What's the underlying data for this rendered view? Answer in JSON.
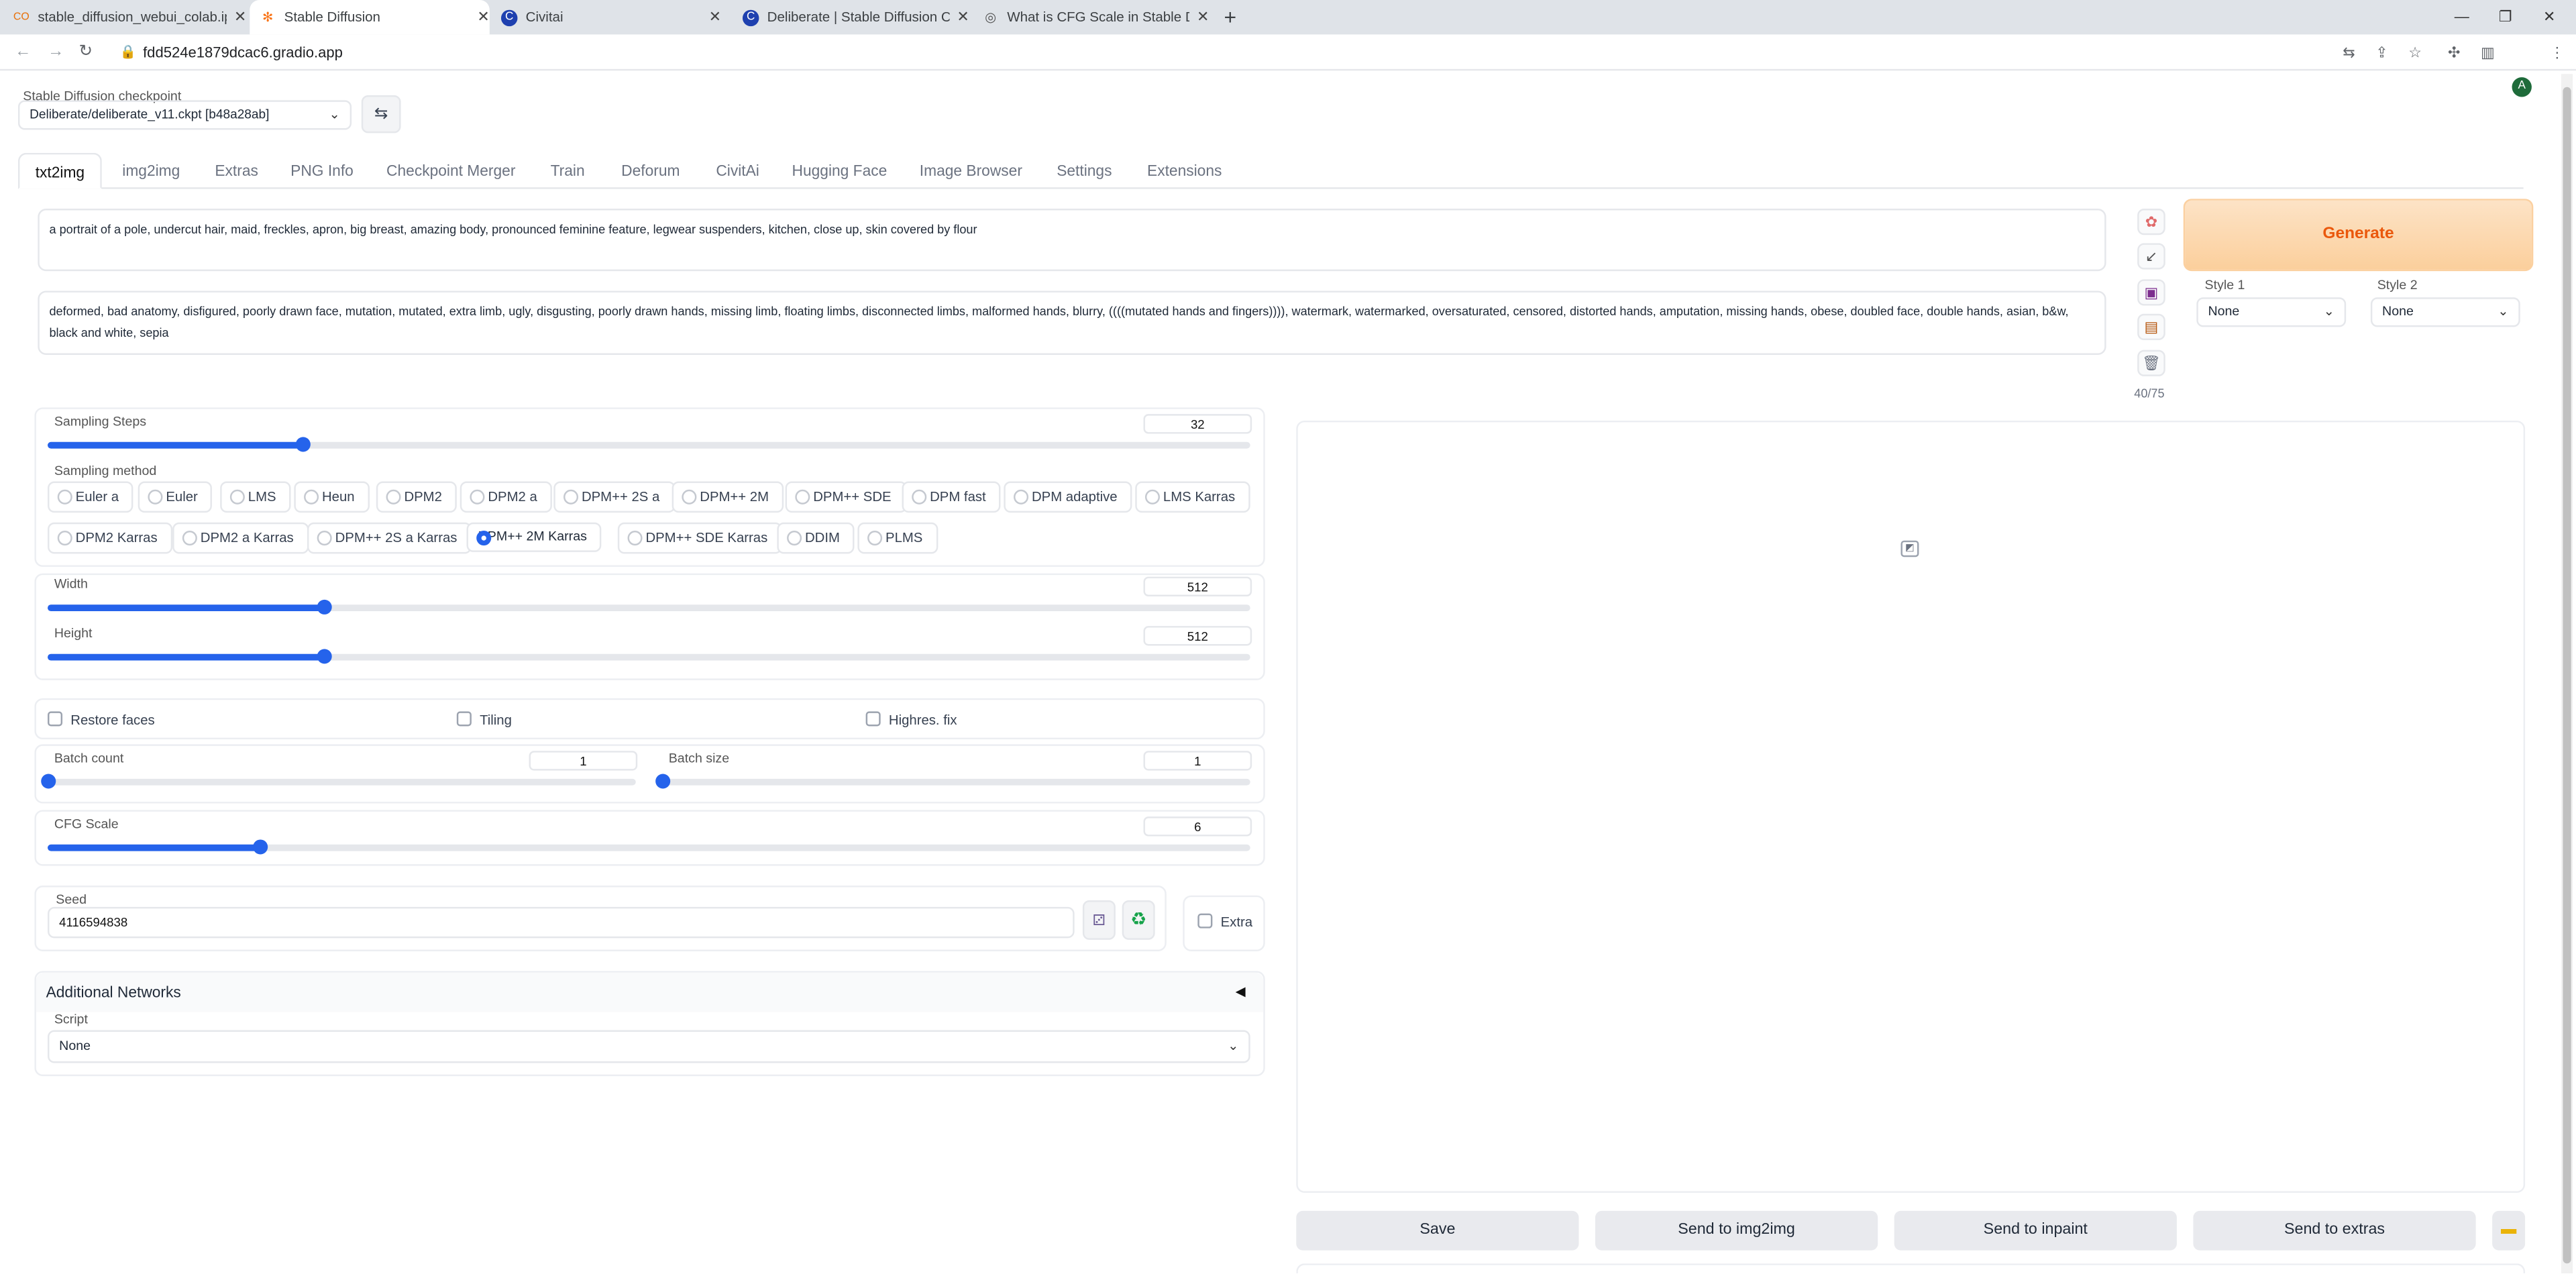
{
  "browser": {
    "tabs": [
      {
        "title": "stable_diffusion_webui_colab.ipynb",
        "icon": "CO"
      },
      {
        "title": "Stable Diffusion",
        "icon": "✻"
      },
      {
        "title": "Civitai",
        "icon": "C"
      },
      {
        "title": "Deliberate | Stable Diffusion Checkpoint",
        "icon": "C"
      },
      {
        "title": "What is CFG Scale in Stable Diffusion",
        "icon": "◎"
      }
    ],
    "url": "fdd524e1879dcac6.gradio.app",
    "avatar": "A"
  },
  "checkpoint": {
    "label": "Stable Diffusion checkpoint",
    "value": "Deliberate/deliberate_v11.ckpt [b48a28ab]"
  },
  "tabs": [
    "txt2img",
    "img2img",
    "Extras",
    "PNG Info",
    "Checkpoint Merger",
    "Train",
    "Deforum",
    "CivitAi",
    "Hugging Face",
    "Image Browser",
    "Settings",
    "Extensions"
  ],
  "prompt": "a portrait of a pole, undercut hair, maid, freckles, apron, big breast, amazing body, pronounced feminine feature, legwear suspenders, kitchen, close up, skin covered by flour",
  "negative_prompt": "deformed, bad anatomy, disfigured, poorly drawn face, mutation, mutated, extra limb, ugly, disgusting, poorly drawn hands, missing limb, floating limbs, disconnected limbs, malformed hands, blurry, ((((mutated hands and fingers)))), watermark, watermarked, oversaturated, censored, distorted hands, amputation, missing hands, obese, doubled face, double hands, asian, b&w, black and white, sepia",
  "token_count": "40/75",
  "generate_label": "Generate",
  "styles": [
    {
      "label": "Style 1",
      "value": "None"
    },
    {
      "label": "Style 2",
      "value": "None"
    }
  ],
  "sampling_steps": {
    "label": "Sampling Steps",
    "value": "32",
    "level": 0.212
  },
  "sampling_method": {
    "label": "Sampling method",
    "row1": [
      "Euler a",
      "Euler",
      "LMS",
      "Heun",
      "DPM2",
      "DPM2 a",
      "DPM++ 2S a",
      "DPM++ 2M",
      "DPM++ SDE",
      "DPM fast",
      "DPM adaptive",
      "LMS Karras"
    ],
    "row2": [
      "DPM2 Karras",
      "DPM2 a Karras",
      "DPM++ 2S a Karras",
      "DPM++ 2M Karras",
      "DPM++ SDE Karras",
      "DDIM",
      "PLMS"
    ],
    "selected": "DPM++ 2M Karras"
  },
  "width": {
    "label": "Width",
    "value": "512",
    "level": 0.229
  },
  "height": {
    "label": "Height",
    "value": "512",
    "level": 0.229
  },
  "checkboxes": {
    "restore_faces": "Restore faces",
    "tiling": "Tiling",
    "highres_fix": "Highres. fix"
  },
  "batch_count": {
    "label": "Batch count",
    "value": "1",
    "level": 0.0
  },
  "batch_size": {
    "label": "Batch size",
    "value": "1",
    "level": 0.0
  },
  "cfg_scale": {
    "label": "CFG Scale",
    "value": "6",
    "level": 0.176
  },
  "seed": {
    "label": "Seed",
    "value": "4116594838",
    "extra_label": "Extra"
  },
  "additional_networks": {
    "label": "Additional Networks",
    "toggle": "◀"
  },
  "script": {
    "label": "Script",
    "value": "None"
  },
  "output_buttons": [
    "Save",
    "Send to img2img",
    "Send to inpaint",
    "Send to extras"
  ],
  "colors": {
    "accent": "#2563eb",
    "generate_bg": "#fbd6ad",
    "generate_text": "#ea580c"
  }
}
